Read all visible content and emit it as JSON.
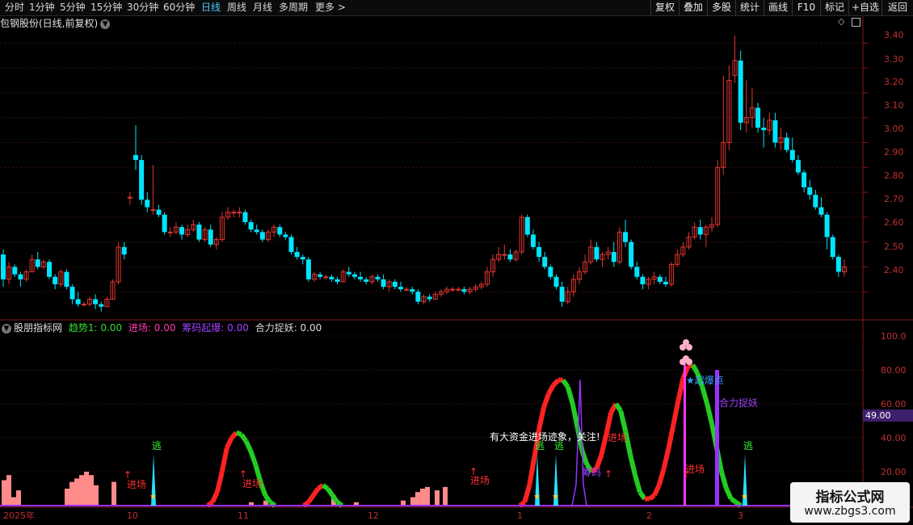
{
  "toolbar": {
    "timeframes": [
      "分时",
      "1分钟",
      "5分钟",
      "15分钟",
      "30分钟",
      "60分钟",
      "日线",
      "周线",
      "月线",
      "多周期",
      "更多 >"
    ],
    "active_timeframe": "日线",
    "right_buttons": [
      "复权",
      "叠加",
      "多股",
      "统计",
      "画线",
      "F10",
      "标记",
      "+自选",
      "返回"
    ]
  },
  "stock": {
    "title": "包钢股份(日线,前复权)"
  },
  "price_axis": {
    "ticks": [
      "3.40",
      "3.30",
      "3.20",
      "3.10",
      "3.00",
      "2.90",
      "2.80",
      "2.70",
      "2.60",
      "2.50",
      "2.40"
    ]
  },
  "indicator": {
    "name": "股朋指标网",
    "values": [
      {
        "label": "趋势1: 0.00",
        "color": "#33dd33"
      },
      {
        "label": "进场: 0.00",
        "color": "#ff3ab3"
      },
      {
        "label": "筹码起爆: 0.00",
        "color": "#a040ff"
      },
      {
        "label": "合力捉妖: 0.00",
        "color": "#dddddd"
      }
    ],
    "axis_ticks": [
      "100.0",
      "80.00",
      "60.00",
      "40.00",
      "20.00"
    ],
    "current_value": "49.00"
  },
  "date_axis": [
    "2025年",
    "10",
    "11",
    "12",
    "1",
    "2",
    "3"
  ],
  "annotations": {
    "enter": "进场",
    "escape": "逃",
    "chips": "筹码",
    "qibao": "★起爆点",
    "heli": "合力捉妖",
    "bigfund": "有大资金进场迹象，关注!"
  },
  "chart_data": {
    "type": "candlestick",
    "title": "包钢股份(日线,前复权)",
    "ylim": [
      2.3,
      3.45
    ],
    "bull_color": "#e0362f",
    "bear_color": "#00e5ff",
    "candles": [
      [
        2.55,
        2.57,
        2.42,
        2.45
      ],
      [
        2.45,
        2.52,
        2.43,
        2.5
      ],
      [
        2.5,
        2.51,
        2.46,
        2.47
      ],
      [
        2.47,
        2.48,
        2.42,
        2.45
      ],
      [
        2.45,
        2.49,
        2.44,
        2.48
      ],
      [
        2.48,
        2.55,
        2.48,
        2.53
      ],
      [
        2.53,
        2.56,
        2.49,
        2.5
      ],
      [
        2.5,
        2.53,
        2.49,
        2.52
      ],
      [
        2.52,
        2.53,
        2.45,
        2.46
      ],
      [
        2.46,
        2.47,
        2.41,
        2.43
      ],
      [
        2.43,
        2.49,
        2.42,
        2.48
      ],
      [
        2.48,
        2.49,
        2.41,
        2.42
      ],
      [
        2.42,
        2.43,
        2.35,
        2.37
      ],
      [
        2.37,
        2.4,
        2.34,
        2.35
      ],
      [
        2.35,
        2.36,
        2.34,
        2.35
      ],
      [
        2.35,
        2.38,
        2.34,
        2.37
      ],
      [
        2.37,
        2.39,
        2.33,
        2.35
      ],
      [
        2.35,
        2.36,
        2.32,
        2.34
      ],
      [
        2.34,
        2.38,
        2.34,
        2.37
      ],
      [
        2.37,
        2.45,
        2.37,
        2.44
      ],
      [
        2.44,
        2.6,
        2.43,
        2.58
      ],
      [
        2.58,
        2.6,
        2.53,
        2.55
      ],
      [
        2.78,
        2.8,
        2.75,
        2.78
      ],
      [
        2.95,
        3.07,
        2.89,
        2.93
      ],
      [
        2.93,
        2.95,
        2.75,
        2.77
      ],
      [
        2.77,
        2.8,
        2.72,
        2.74
      ],
      [
        2.73,
        2.91,
        2.71,
        2.73
      ],
      [
        2.73,
        2.75,
        2.7,
        2.71
      ],
      [
        2.71,
        2.72,
        2.63,
        2.64
      ],
      [
        2.64,
        2.66,
        2.62,
        2.64
      ],
      [
        2.64,
        2.68,
        2.63,
        2.66
      ],
      [
        2.66,
        2.67,
        2.61,
        2.63
      ],
      [
        2.63,
        2.67,
        2.62,
        2.65
      ],
      [
        2.65,
        2.69,
        2.64,
        2.67
      ],
      [
        2.67,
        2.68,
        2.6,
        2.61
      ],
      [
        2.61,
        2.66,
        2.6,
        2.65
      ],
      [
        2.65,
        2.67,
        2.58,
        2.59
      ],
      [
        2.59,
        2.62,
        2.57,
        2.61
      ],
      [
        2.61,
        2.72,
        2.6,
        2.7
      ],
      [
        2.7,
        2.74,
        2.69,
        2.72
      ],
      [
        2.72,
        2.73,
        2.7,
        2.72
      ],
      [
        2.72,
        2.74,
        2.7,
        2.72
      ],
      [
        2.72,
        2.73,
        2.67,
        2.68
      ],
      [
        2.68,
        2.69,
        2.64,
        2.65
      ],
      [
        2.65,
        2.67,
        2.63,
        2.64
      ],
      [
        2.64,
        2.65,
        2.6,
        2.61
      ],
      [
        2.61,
        2.65,
        2.6,
        2.64
      ],
      [
        2.64,
        2.67,
        2.62,
        2.66
      ],
      [
        2.66,
        2.67,
        2.62,
        2.63
      ],
      [
        2.63,
        2.64,
        2.61,
        2.62
      ],
      [
        2.62,
        2.63,
        2.55,
        2.56
      ],
      [
        2.56,
        2.58,
        2.53,
        2.54
      ],
      [
        2.54,
        2.55,
        2.51,
        2.53
      ],
      [
        2.53,
        2.54,
        2.44,
        2.45
      ],
      [
        2.45,
        2.48,
        2.44,
        2.47
      ],
      [
        2.47,
        2.48,
        2.45,
        2.46
      ],
      [
        2.46,
        2.47,
        2.45,
        2.46
      ],
      [
        2.46,
        2.47,
        2.44,
        2.45
      ],
      [
        2.45,
        2.46,
        2.43,
        2.44
      ],
      [
        2.44,
        2.49,
        2.44,
        2.48
      ],
      [
        2.48,
        2.5,
        2.46,
        2.47
      ],
      [
        2.47,
        2.48,
        2.45,
        2.46
      ],
      [
        2.46,
        2.48,
        2.44,
        2.45
      ],
      [
        2.45,
        2.46,
        2.43,
        2.44
      ],
      [
        2.44,
        2.47,
        2.43,
        2.46
      ],
      [
        2.46,
        2.47,
        2.44,
        2.45
      ],
      [
        2.45,
        2.47,
        2.41,
        2.42
      ],
      [
        2.42,
        2.45,
        2.4,
        2.44
      ],
      [
        2.44,
        2.45,
        2.41,
        2.42
      ],
      [
        2.42,
        2.44,
        2.4,
        2.41
      ],
      [
        2.41,
        2.42,
        2.4,
        2.41
      ],
      [
        2.41,
        2.42,
        2.39,
        2.4
      ],
      [
        2.4,
        2.41,
        2.35,
        2.36
      ],
      [
        2.36,
        2.39,
        2.35,
        2.38
      ],
      [
        2.38,
        2.39,
        2.36,
        2.37
      ],
      [
        2.37,
        2.4,
        2.37,
        2.39
      ],
      [
        2.39,
        2.41,
        2.38,
        2.4
      ],
      [
        2.4,
        2.42,
        2.39,
        2.41
      ],
      [
        2.41,
        2.42,
        2.4,
        2.41
      ],
      [
        2.41,
        2.42,
        2.4,
        2.41
      ],
      [
        2.41,
        2.42,
        2.39,
        2.4
      ],
      [
        2.4,
        2.42,
        2.39,
        2.41
      ],
      [
        2.41,
        2.43,
        2.4,
        2.42
      ],
      [
        2.42,
        2.44,
        2.41,
        2.43
      ],
      [
        2.43,
        2.5,
        2.42,
        2.48
      ],
      [
        2.48,
        2.55,
        2.46,
        2.53
      ],
      [
        2.53,
        2.58,
        2.52,
        2.55
      ],
      [
        2.55,
        2.59,
        2.53,
        2.55
      ],
      [
        2.55,
        2.57,
        2.52,
        2.53
      ],
      [
        2.53,
        2.57,
        2.52,
        2.56
      ],
      [
        2.56,
        2.71,
        2.55,
        2.7
      ],
      [
        2.7,
        2.71,
        2.62,
        2.63
      ],
      [
        2.63,
        2.65,
        2.57,
        2.58
      ],
      [
        2.58,
        2.6,
        2.52,
        2.54
      ],
      [
        2.54,
        2.56,
        2.49,
        2.5
      ],
      [
        2.5,
        2.51,
        2.45,
        2.46
      ],
      [
        2.46,
        2.47,
        2.41,
        2.42
      ],
      [
        2.42,
        2.44,
        2.34,
        2.36
      ],
      [
        2.36,
        2.42,
        2.35,
        2.4
      ],
      [
        2.4,
        2.47,
        2.38,
        2.45
      ],
      [
        2.45,
        2.5,
        2.43,
        2.48
      ],
      [
        2.48,
        2.55,
        2.47,
        2.52
      ],
      [
        2.52,
        2.61,
        2.51,
        2.58
      ],
      [
        2.58,
        2.6,
        2.52,
        2.53
      ],
      [
        2.53,
        2.56,
        2.5,
        2.55
      ],
      [
        2.55,
        2.58,
        2.53,
        2.56
      ],
      [
        2.56,
        2.6,
        2.5,
        2.52
      ],
      [
        2.52,
        2.66,
        2.51,
        2.64
      ],
      [
        2.64,
        2.69,
        2.58,
        2.6
      ],
      [
        2.6,
        2.61,
        2.49,
        2.5
      ],
      [
        2.5,
        2.52,
        2.45,
        2.46
      ],
      [
        2.46,
        2.47,
        2.41,
        2.43
      ],
      [
        2.43,
        2.46,
        2.41,
        2.45
      ],
      [
        2.45,
        2.48,
        2.43,
        2.46
      ],
      [
        2.46,
        2.47,
        2.43,
        2.44
      ],
      [
        2.44,
        2.46,
        2.42,
        2.43
      ],
      [
        2.43,
        2.52,
        2.42,
        2.51
      ],
      [
        2.51,
        2.57,
        2.5,
        2.55
      ],
      [
        2.55,
        2.6,
        2.54,
        2.58
      ],
      [
        2.58,
        2.64,
        2.57,
        2.62
      ],
      [
        2.62,
        2.68,
        2.61,
        2.66
      ],
      [
        2.66,
        2.69,
        2.61,
        2.63
      ],
      [
        2.63,
        2.67,
        2.58,
        2.66
      ],
      [
        2.66,
        2.7,
        2.64,
        2.67
      ],
      [
        2.67,
        2.93,
        2.66,
        2.9
      ],
      [
        2.9,
        3.27,
        2.87,
        3.0
      ],
      [
        3.0,
        3.31,
        2.97,
        3.25
      ],
      [
        3.27,
        3.43,
        3.24,
        3.33
      ],
      [
        3.33,
        3.37,
        3.05,
        3.08
      ],
      [
        3.08,
        3.25,
        3.04,
        3.1
      ],
      [
        3.1,
        3.22,
        3.06,
        3.14
      ],
      [
        3.14,
        3.16,
        3.04,
        3.06
      ],
      [
        3.06,
        3.1,
        2.98,
        3.05
      ],
      [
        3.05,
        3.12,
        3.03,
        3.09
      ],
      [
        3.09,
        3.12,
        2.98,
        3.0
      ],
      [
        3.0,
        3.06,
        2.97,
        3.02
      ],
      [
        3.02,
        3.04,
        2.96,
        2.97
      ],
      [
        2.97,
        3.02,
        2.92,
        2.93
      ],
      [
        2.93,
        2.95,
        2.87,
        2.88
      ],
      [
        2.88,
        2.89,
        2.8,
        2.82
      ],
      [
        2.82,
        2.85,
        2.77,
        2.79
      ],
      [
        2.79,
        2.81,
        2.73,
        2.74
      ],
      [
        2.74,
        2.78,
        2.7,
        2.71
      ],
      [
        2.71,
        2.72,
        2.57,
        2.62
      ],
      [
        2.62,
        2.63,
        2.53,
        2.54
      ],
      [
        2.54,
        2.55,
        2.46,
        2.48
      ],
      [
        2.48,
        2.53,
        2.46,
        2.5
      ]
    ],
    "trend_line": [
      0,
      0,
      0,
      0,
      0,
      0,
      0,
      0,
      0,
      0,
      0,
      0,
      0,
      0,
      0,
      0,
      0,
      0,
      0,
      2,
      8,
      20,
      34,
      40,
      43,
      42,
      38,
      32,
      24,
      14,
      6,
      2,
      0,
      0,
      0,
      0,
      0,
      0,
      0,
      2,
      6,
      10,
      12,
      10,
      6,
      2,
      0,
      0,
      0,
      0,
      0,
      0,
      0,
      0,
      0,
      0,
      0,
      0,
      0,
      0,
      0,
      0,
      0,
      0,
      0,
      0,
      0,
      0,
      0,
      0,
      0,
      0,
      0,
      0,
      0,
      0,
      0,
      0,
      0,
      0,
      0,
      0,
      0,
      0,
      2,
      12,
      28,
      45,
      58,
      66,
      71,
      74,
      74,
      70,
      60,
      46,
      32,
      24,
      20,
      22,
      30,
      42,
      55,
      60,
      56,
      44,
      30,
      18,
      8,
      4,
      4,
      6,
      12,
      22,
      34,
      48,
      62,
      75,
      82,
      83,
      78,
      70,
      60,
      48,
      34,
      20,
      10,
      4,
      2,
      0,
      0,
      0,
      0,
      0,
      0,
      0,
      0,
      0,
      0,
      0,
      0,
      0,
      0,
      0
    ]
  }
}
